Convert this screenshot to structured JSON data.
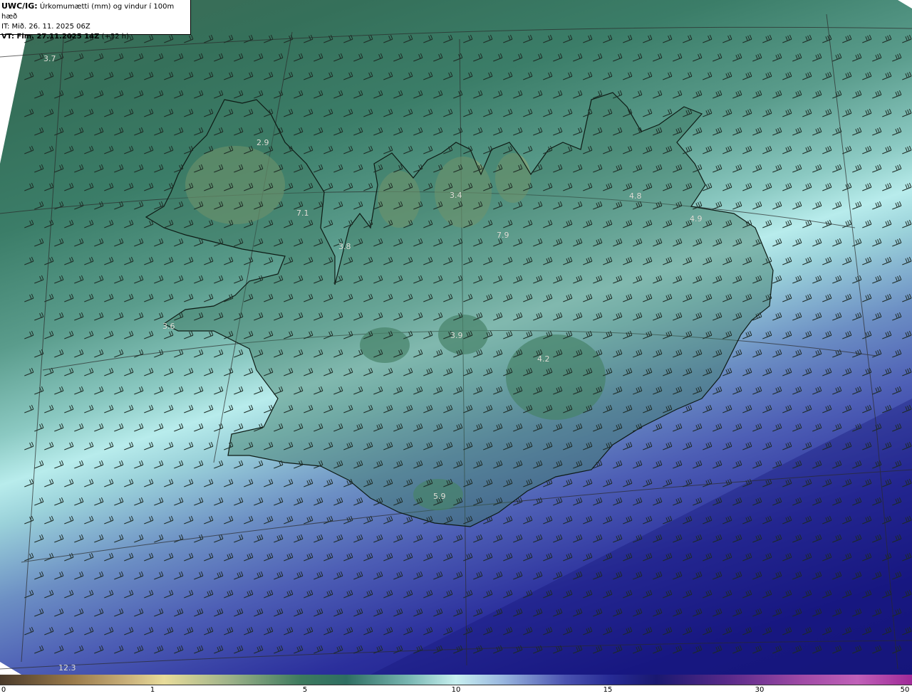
{
  "header": {
    "line1_bold": "UWC/IG:",
    "line1_rest": "Úrkomumætti (mm) og vindur í 100m hæð",
    "line2": "IT: Mið. 26. 11. 2025 06Z",
    "line3_bold": "VT: Fim. 27.11.2025 14Z",
    "line3_rest": "(+32 h)"
  },
  "map_values": [
    "3.7",
    "2.9",
    "7.1",
    "3.8",
    "3.4",
    "7.9",
    "4.8",
    "4.9",
    "3.6",
    "3.9",
    "4.2",
    "5.9",
    "12.3"
  ],
  "colorbar": {
    "ticks": [
      "0",
      "1",
      "5",
      "10",
      "15",
      "30",
      "50"
    ]
  },
  "colors": {
    "coast": "#0d1a14",
    "grid": "#2a2a2a",
    "barb": "#1e2a24"
  }
}
